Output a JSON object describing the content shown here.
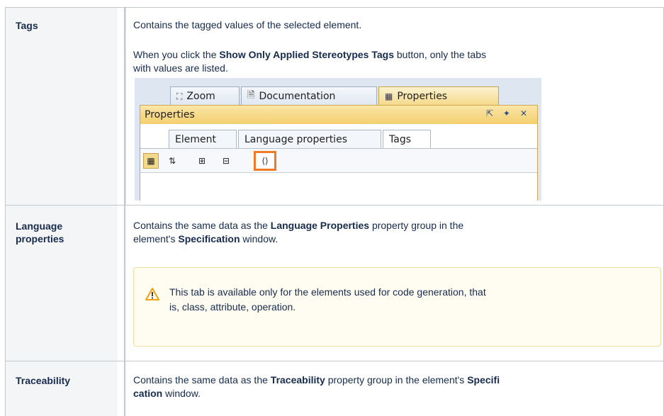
{
  "rows": {
    "tags": {
      "label": "Tags",
      "desc": "Contains the tagged values of the selected element.",
      "note_pre": "When you click the ",
      "note_bold": "Show Only Applied Stereotypes Tags",
      "note_post_1": " button, only the tabs",
      "note_post_2": "with values are listed."
    },
    "language": {
      "label_1": "Language",
      "label_2": "properties",
      "desc_pre": "Contains the same data as the ",
      "desc_bold": "Language Properties",
      "desc_post": " property group in the",
      "desc2_pre": "element's ",
      "desc2_bold": "Specification",
      "desc2_post": " window.",
      "warning_line1": "This tab is available only for the elements used for code generation, that",
      "warning_line2": "is, class, attribute, operation."
    },
    "traceability": {
      "label": "Traceability",
      "desc_pre": "Contains the same data as the ",
      "desc_bold": "Traceability",
      "desc_mid": " property group in the element's ",
      "desc_bold2": "Specifi",
      "desc2_bold": "cation",
      "desc2_post": " window."
    }
  },
  "screenshot": {
    "tabs": [
      "Zoom",
      "Documentation",
      "Properties"
    ],
    "panel_title": "Properties",
    "subtabs": [
      "Element",
      "Language properties",
      "Tags"
    ],
    "colors": {
      "highlight": "#f07a26",
      "panel_header": "#f3cf6e"
    }
  }
}
